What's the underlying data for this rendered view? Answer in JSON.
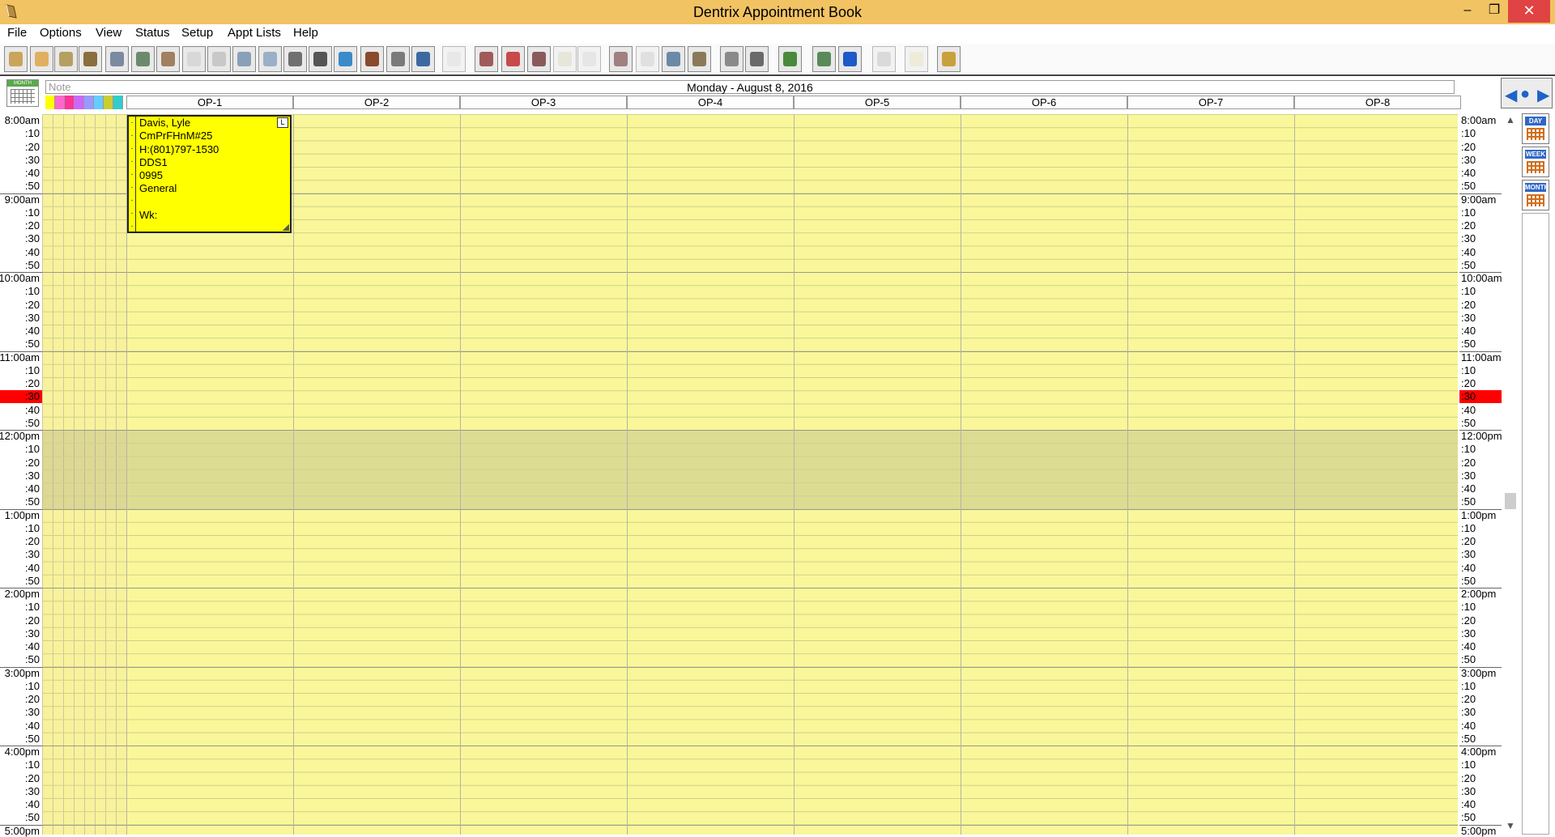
{
  "window": {
    "title": "Dentrix Appointment Book",
    "minimize": "–",
    "maximize": "❐",
    "close": "✕"
  },
  "menu": [
    "File",
    "Options",
    "View",
    "Status",
    "Setup",
    "Appt Lists",
    "Help"
  ],
  "toolbar": {
    "buttons": [
      {
        "icon": "office-manager-icon",
        "color": "#c9a45a"
      },
      {
        "icon": "family-file-icon",
        "color": "#e0b060"
      },
      {
        "icon": "ledger-icon",
        "color": "#b5a060"
      },
      {
        "icon": "chart-icon",
        "color": "#8a6e3c"
      },
      {
        "icon": "patient-info-icon",
        "color": "#7a8aa0"
      },
      {
        "icon": "treatment-planner-icon",
        "color": "#6b8a6b"
      },
      {
        "icon": "quick-letters-icon",
        "color": "#a08060"
      },
      {
        "icon": "eraser-icon",
        "color": "#d8d8d8"
      },
      {
        "icon": "notes-icon",
        "color": "#c8c8c8"
      },
      {
        "icon": "continuing-care-icon",
        "color": "#8aa0b8"
      },
      {
        "icon": "email-icon",
        "color": "#9ab0c8"
      },
      {
        "icon": "document-center-icon",
        "color": "#707070"
      },
      {
        "icon": "rx-icon",
        "color": "#555555"
      },
      {
        "icon": "perio-icon",
        "color": "#3c8ac8"
      },
      {
        "icon": "clinical-notes-icon",
        "color": "#8a4a2c"
      },
      {
        "icon": "image-icon",
        "color": "#7a7a7a"
      },
      {
        "icon": "mail-icon",
        "color": "#3c6aa0"
      },
      {
        "icon": "blank-icon",
        "color": "#d8d8d8"
      },
      {
        "icon": "schedule-appt-icon",
        "color": "#a05a5a"
      },
      {
        "icon": "find-appt-icon",
        "color": "#c84a4a"
      },
      {
        "icon": "find-new-appt-icon",
        "color": "#8a5a5a"
      },
      {
        "icon": "waves-icon",
        "color": "#d0d0b0"
      },
      {
        "icon": "check-icon",
        "color": "#d0d0d0"
      },
      {
        "icon": "print-icon",
        "color": "#a08080"
      },
      {
        "icon": "print-disabled-icon",
        "color": "#c0c0c0"
      },
      {
        "icon": "patient-portrait-icon",
        "color": "#6a8aa8"
      },
      {
        "icon": "family-portrait-icon",
        "color": "#8a7a5a"
      },
      {
        "icon": "info-icon",
        "color": "#8a8a8a"
      },
      {
        "icon": "delete-icon",
        "color": "#6a6a6a"
      },
      {
        "icon": "payment-icon",
        "color": "#4a8a3a"
      },
      {
        "icon": "glasses-icon",
        "color": "#5a8a5a"
      },
      {
        "icon": "time-arrows-icon",
        "color": "#1e5ac8"
      },
      {
        "icon": "tooth-icon",
        "color": "#b0b0b0"
      },
      {
        "icon": "hand-icon",
        "color": "#e8e0b0"
      },
      {
        "icon": "sidebar-icon",
        "color": "#c8a03c"
      }
    ]
  },
  "header": {
    "note_placeholder": "Note",
    "date": "Monday - August 8, 2016",
    "ops": [
      "OP-1",
      "OP-2",
      "OP-3",
      "OP-4",
      "OP-5",
      "OP-6",
      "OP-7",
      "OP-8"
    ],
    "swatch_colors": [
      "#ffff00",
      "#ff66cc",
      "#ff3399",
      "#cc66ff",
      "#9999ff",
      "#66ccff",
      "#cccc33",
      "#33cccc"
    ]
  },
  "times": [
    "8:00am",
    ":10",
    ":20",
    ":30",
    ":40",
    ":50",
    "9:00am",
    ":10",
    ":20",
    ":30",
    ":40",
    ":50",
    "10:00am",
    ":10",
    ":20",
    ":30",
    ":40",
    ":50",
    "11:00am",
    ":10",
    ":20",
    ":30",
    ":40",
    ":50",
    "12:00pm",
    ":10",
    ":20",
    ":30",
    ":40",
    ":50",
    "1:00pm",
    ":10",
    ":20",
    ":30",
    ":40",
    ":50",
    "2:00pm",
    ":10",
    ":20",
    ":30",
    ":40",
    ":50",
    "3:00pm",
    ":10",
    ":20",
    ":30",
    ":40",
    ":50",
    "4:00pm",
    ":10",
    ":20",
    ":30",
    ":40",
    ":50",
    "5:00pm"
  ],
  "current_time_index": 21,
  "lunch": {
    "start_index": 24,
    "end_index": 30
  },
  "appointment": {
    "op": "OP-1",
    "start": "8:00am",
    "color": "#ffff00",
    "lines": [
      "Davis, Lyle",
      "CmPrFHnM#25",
      "H:(801)797-1530",
      "DDS1",
      "0995",
      "General",
      "",
      "Wk:"
    ],
    "flag": "L"
  },
  "nav": {
    "prev": "◀",
    "today": "●",
    "next": "▶"
  },
  "views": [
    {
      "label": "DAY"
    },
    {
      "label": "WEEK"
    },
    {
      "label": "MONTH"
    }
  ],
  "monthicon_label": "MONTH",
  "scroll": {
    "up": "▲",
    "down": "▼"
  },
  "colors": {
    "title_bar": "#f1c363",
    "grid_yellow": "#f9f79a",
    "appointment": "#ffff00",
    "current_time": "#ff0000",
    "close_button": "#e04343"
  }
}
